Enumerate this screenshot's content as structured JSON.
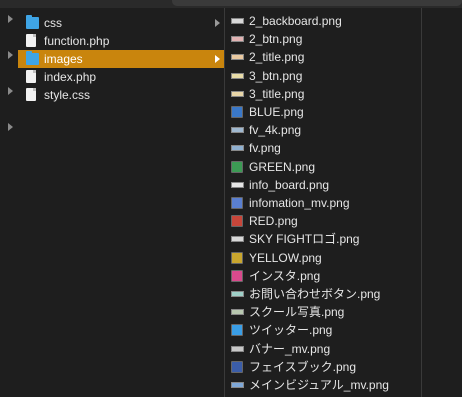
{
  "col1": {
    "items": [
      {
        "label": "css",
        "icon": "folder-icon",
        "arrow": true,
        "selected": false
      },
      {
        "label": "function.php",
        "icon": "document-icon",
        "arrow": false,
        "selected": false
      },
      {
        "label": "images",
        "icon": "folder-icon",
        "arrow": true,
        "selected": true
      },
      {
        "label": "index.php",
        "icon": "document-icon",
        "arrow": false,
        "selected": false
      },
      {
        "label": "style.css",
        "icon": "document-icon",
        "arrow": false,
        "selected": false
      }
    ]
  },
  "col2": {
    "items": [
      {
        "label": "2_backboard.png",
        "icon": "image-thumb-icon",
        "color": "#d8d8d8"
      },
      {
        "label": "2_btn.png",
        "icon": "image-thumb-icon",
        "color": "#e2b3b3"
      },
      {
        "label": "2_title.png",
        "icon": "image-thumb-icon",
        "color": "#e9c9a0"
      },
      {
        "label": "3_btn.png",
        "icon": "image-thumb-icon",
        "color": "#e8dca8"
      },
      {
        "label": "3_title.png",
        "icon": "image-thumb-icon",
        "color": "#e8d6a8"
      },
      {
        "label": "BLUE.png",
        "icon": "image-thumb-icon",
        "color": "#3a78c8"
      },
      {
        "label": "fv_4k.png",
        "icon": "image-thumb-icon",
        "color": "#9fb8d0"
      },
      {
        "label": "fv.png",
        "icon": "image-thumb-icon",
        "color": "#8fb0d0"
      },
      {
        "label": "GREEN.png",
        "icon": "image-thumb-icon",
        "color": "#3c9a54"
      },
      {
        "label": "info_board.png",
        "icon": "image-thumb-icon",
        "color": "#e6e6e6"
      },
      {
        "label": "infomation_mv.png",
        "icon": "image-thumb-icon",
        "color": "#5a7fd0"
      },
      {
        "label": "RED.png",
        "icon": "image-thumb-icon",
        "color": "#c8463a"
      },
      {
        "label": "SKY FIGHTロゴ.png",
        "icon": "image-thumb-icon",
        "color": "#d8d8d8"
      },
      {
        "label": "YELLOW.png",
        "icon": "image-thumb-icon",
        "color": "#c9a62e"
      },
      {
        "label": "インスタ.png",
        "icon": "image-thumb-icon",
        "color": "#d94a8c"
      },
      {
        "label": "お問い合わせボタン.png",
        "icon": "image-thumb-icon",
        "color": "#9fd0c8"
      },
      {
        "label": "スクール写真.png",
        "icon": "image-thumb-icon",
        "color": "#b8c8b0"
      },
      {
        "label": "ツイッター.png",
        "icon": "image-thumb-icon",
        "color": "#3a9ee6"
      },
      {
        "label": "バナー_mv.png",
        "icon": "image-thumb-icon",
        "color": "#c8c8c8"
      },
      {
        "label": "フェイスブック.png",
        "icon": "image-thumb-icon",
        "color": "#3b5da8"
      },
      {
        "label": "メインビジュアル_mv.png",
        "icon": "image-thumb-icon",
        "color": "#7fa8d8"
      }
    ]
  },
  "gutter": {
    "arrows": 4
  }
}
